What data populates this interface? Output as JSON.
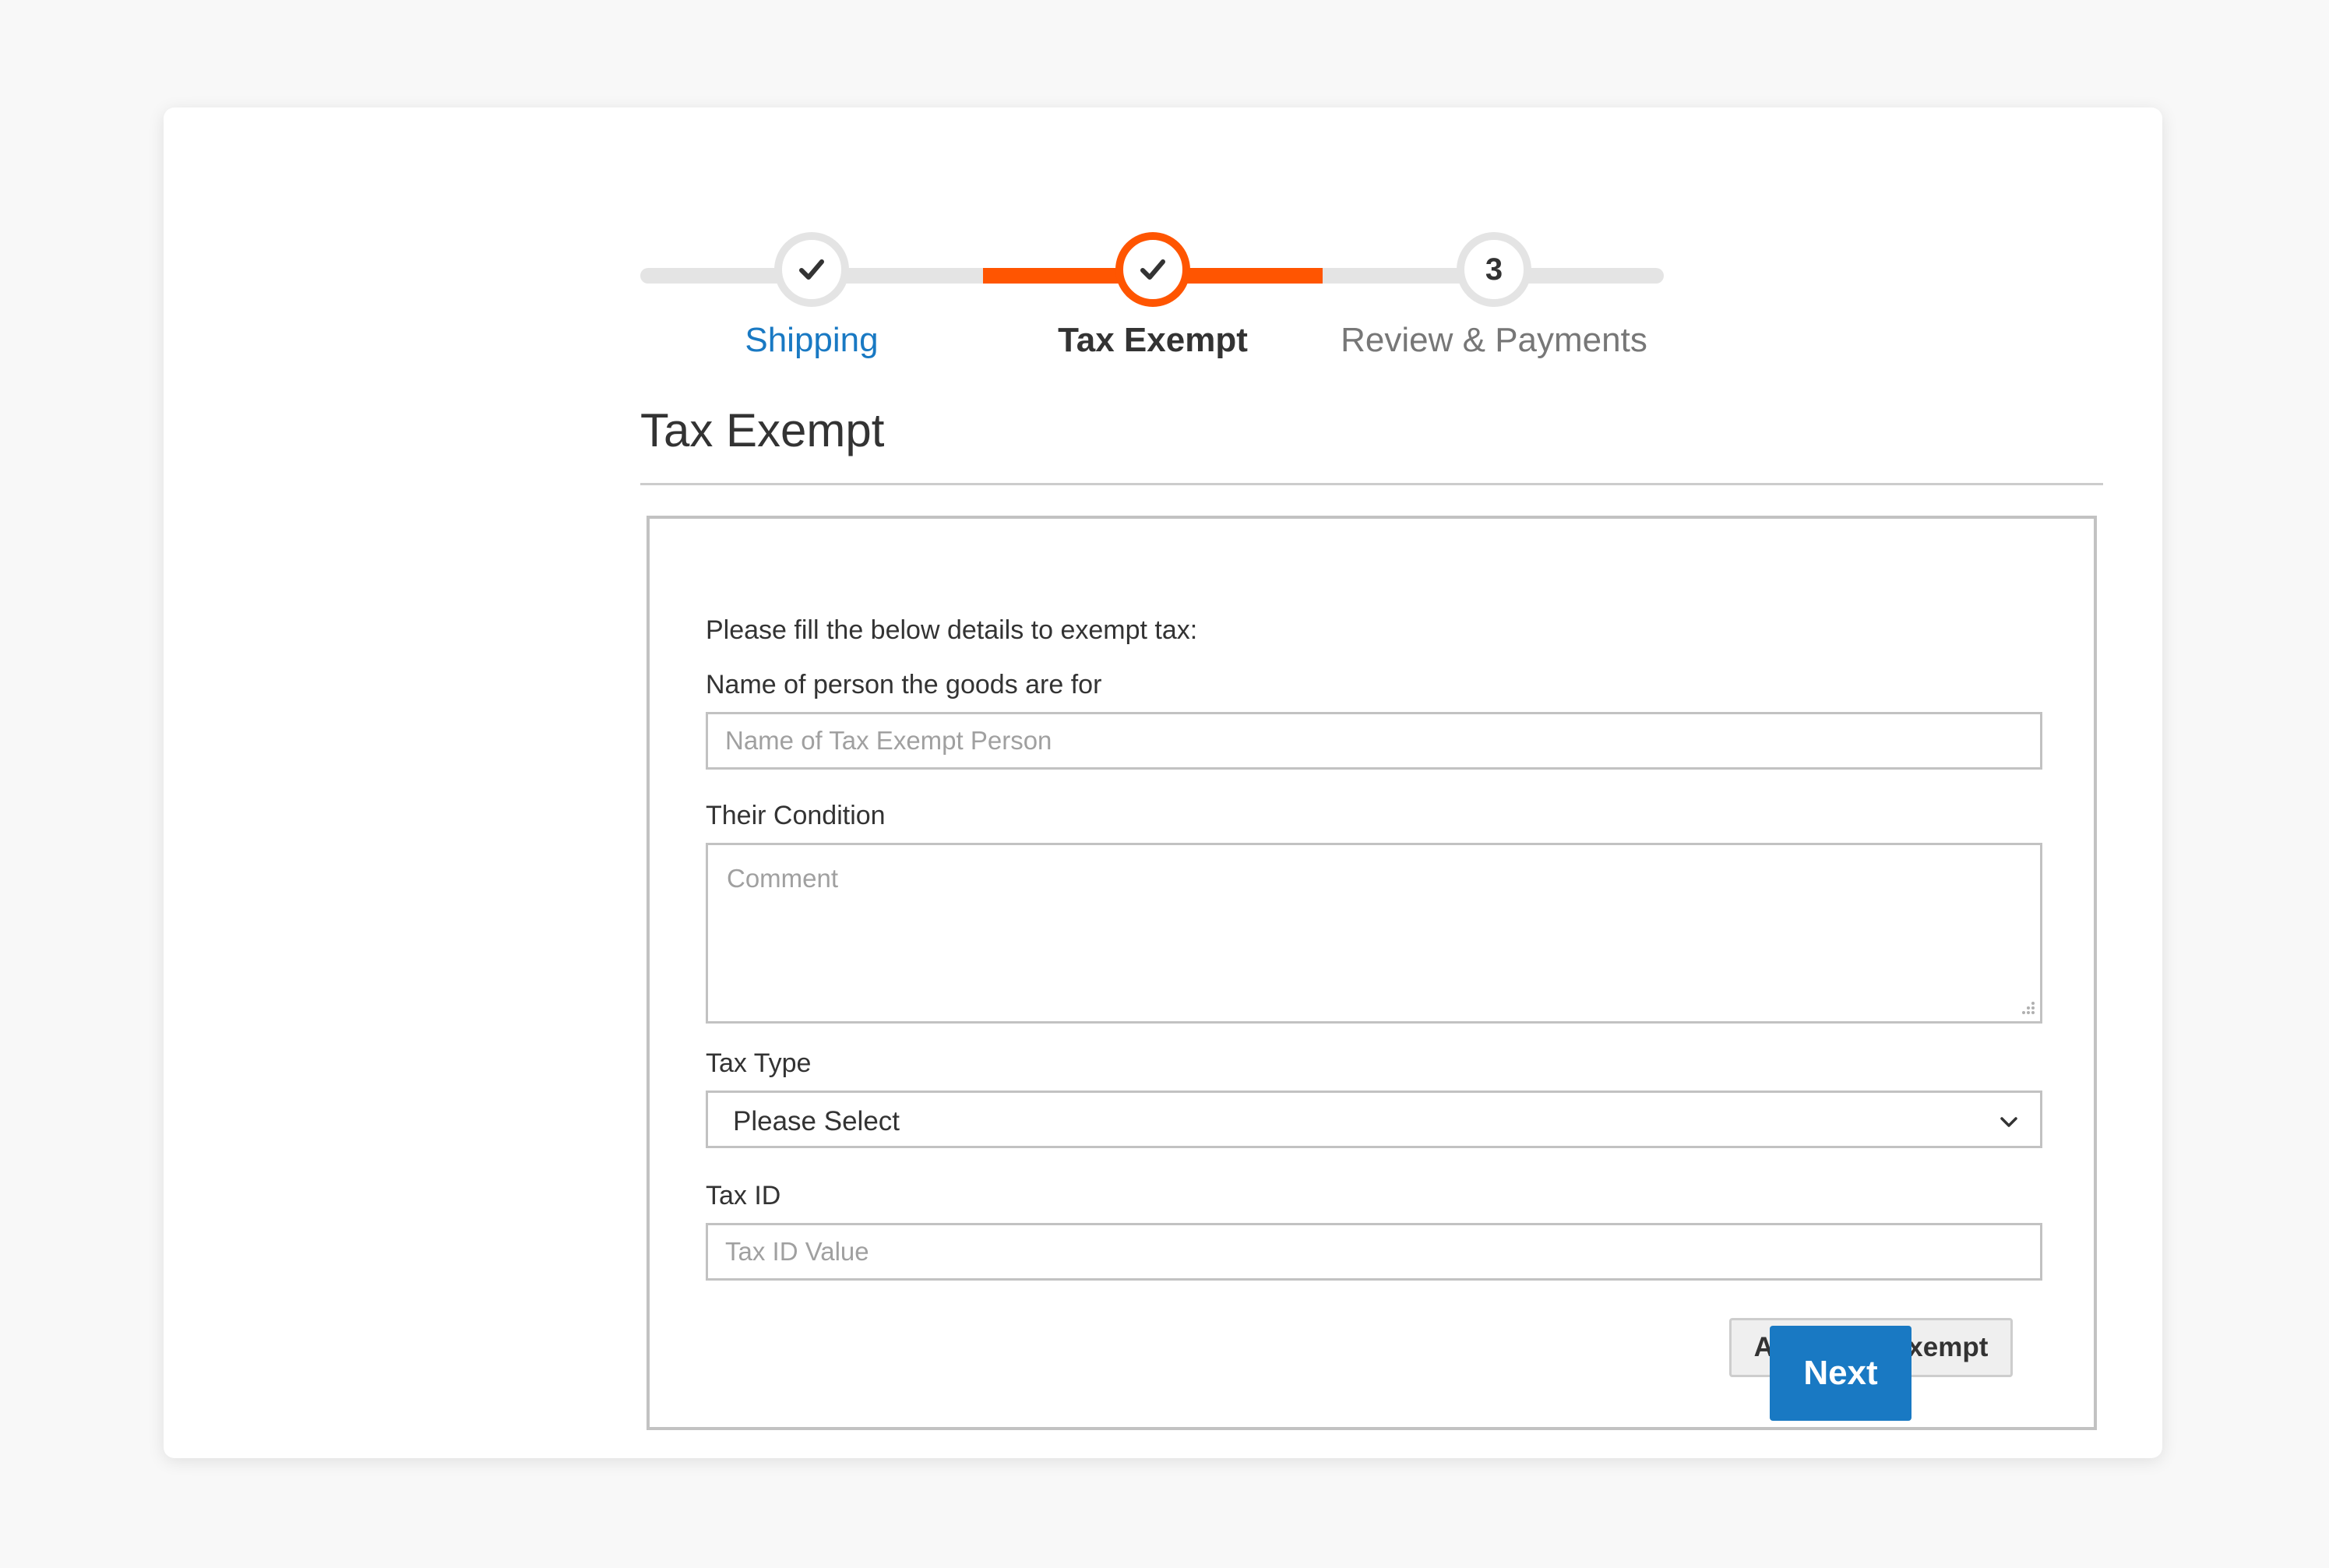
{
  "colors": {
    "accent_orange": "#ff5501",
    "primary_blue": "#1979c3",
    "track_gray": "#e4e4e4",
    "page_background": "#f8f8f8"
  },
  "progress": {
    "steps": [
      {
        "label": "Shipping",
        "status": "complete",
        "marker_icon": "checkmark-icon",
        "marker_text": ""
      },
      {
        "label": "Tax Exempt",
        "status": "current",
        "marker_icon": "checkmark-icon",
        "marker_text": ""
      },
      {
        "label": "Review & Payments",
        "status": "upcoming",
        "marker_icon": "",
        "marker_text": "3"
      }
    ]
  },
  "page": {
    "title": "Tax Exempt"
  },
  "form": {
    "intro": "Please fill the below details to exempt tax:",
    "person_name": {
      "label": "Name of person the goods are for",
      "placeholder": "Name of Tax Exempt Person",
      "value": ""
    },
    "condition": {
      "label": "Their Condition",
      "placeholder": "Comment",
      "value": ""
    },
    "tax_type": {
      "label": "Tax Type",
      "selected": "Please Select",
      "icon": "chevron-down-icon"
    },
    "tax_id": {
      "label": "Tax ID",
      "placeholder": "Tax ID Value",
      "value": ""
    },
    "apply_label": "Apply Tax Exempt"
  },
  "actions": {
    "next_label": "Next"
  }
}
